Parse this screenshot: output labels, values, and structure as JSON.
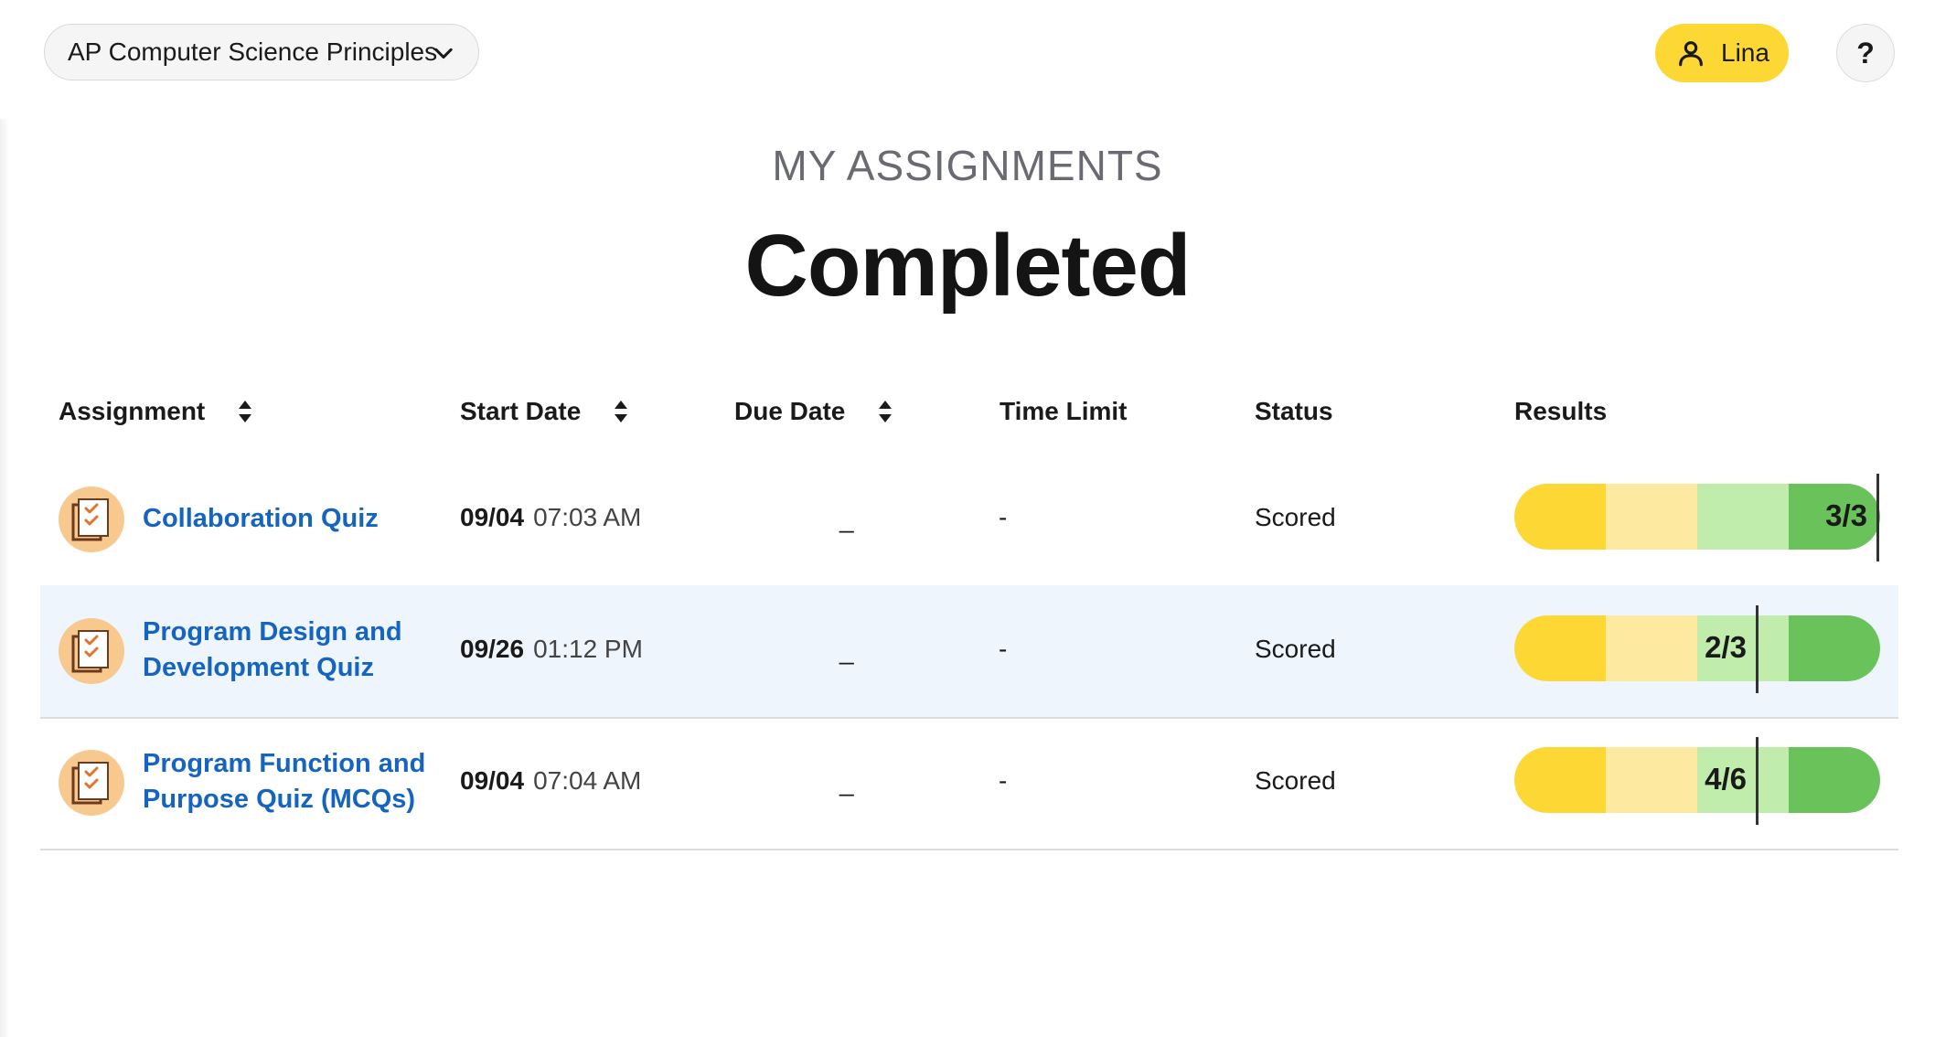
{
  "header": {
    "course_name": "AP Computer Science Principles",
    "user_name": "Lina",
    "help_label": "?"
  },
  "heading": {
    "eyebrow": "MY ASSIGNMENTS",
    "title": "Completed"
  },
  "table": {
    "columns": {
      "assignment": "Assignment",
      "start_date": "Start Date",
      "due_date": "Due Date",
      "time_limit": "Time Limit",
      "status": "Status",
      "results": "Results"
    },
    "rows": [
      {
        "name": "Collaboration Quiz",
        "start_date": "09/04",
        "start_time": "07:03 AM",
        "due": "_",
        "time_limit": "-",
        "status": "Scored",
        "score_label": "3/3",
        "score_fraction": 1.0
      },
      {
        "name": "Program Design and Development Quiz",
        "start_date": "09/26",
        "start_time": "01:12 PM",
        "due": "_",
        "time_limit": "-",
        "status": "Scored",
        "score_label": "2/3",
        "score_fraction": 0.6667
      },
      {
        "name": "Program Function and Purpose Quiz (MCQs)",
        "start_date": "09/04",
        "start_time": "07:04 AM",
        "due": "_",
        "time_limit": "-",
        "status": "Scored",
        "score_label": "4/6",
        "score_fraction": 0.6667
      }
    ]
  },
  "colors": {
    "accent_yellow": "#fdd835",
    "link_blue": "#1565c0",
    "highlight_row": "#eef5fc",
    "result_segments": [
      "#fdd835",
      "#fdeaa0",
      "#c0edac",
      "#6ac35a"
    ]
  },
  "icons": {
    "course_dropdown": "chevron-down-icon",
    "user": "user-icon",
    "sort": "sort-icon",
    "assignment": "quiz-checklist-icon"
  }
}
